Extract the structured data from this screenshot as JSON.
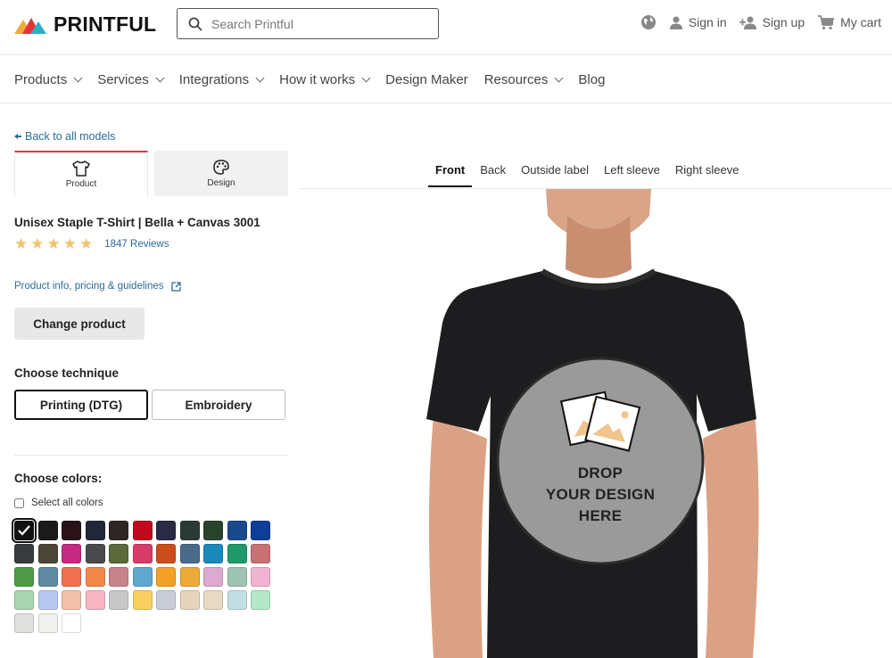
{
  "header": {
    "logo_text": "PRINTFUL",
    "search_placeholder": "Search Printful",
    "actions": {
      "language_icon": "globe-icon",
      "sign_in": "Sign in",
      "sign_up": "Sign up",
      "cart": "My cart"
    }
  },
  "nav": {
    "items": [
      {
        "label": "Products",
        "dropdown": true
      },
      {
        "label": "Services",
        "dropdown": true
      },
      {
        "label": "Integrations",
        "dropdown": true
      },
      {
        "label": "How it works",
        "dropdown": true
      },
      {
        "label": "Design Maker",
        "dropdown": false
      },
      {
        "label": "Resources",
        "dropdown": true
      },
      {
        "label": "Blog",
        "dropdown": false
      }
    ]
  },
  "left_panel": {
    "back_link": "Back to all models",
    "tabs": [
      {
        "label": "Product",
        "icon": "tshirt-icon",
        "active": true
      },
      {
        "label": "Design",
        "icon": "palette-icon",
        "active": false
      }
    ],
    "product_title": "Unisex Staple T-Shirt | Bella + Canvas 3001",
    "rating": {
      "stars": 5,
      "reviews": "1847 Reviews"
    },
    "info_link": "Product info, pricing & guidelines",
    "change_button": "Change product",
    "technique": {
      "label": "Choose technique",
      "options": [
        {
          "label": "Printing (DTG)",
          "selected": true
        },
        {
          "label": "Embroidery",
          "selected": false
        }
      ]
    },
    "colors": {
      "label": "Choose colors:",
      "select_all": "Select all colors",
      "swatches": [
        "#111111",
        "#1a1a1a",
        "#2a1318",
        "#222638",
        "#2d2624",
        "#c00a1c",
        "#2a2a44",
        "#2a3a35",
        "#27432c",
        "#1a4a8c",
        "#0c3e9a",
        "#3a3b3d",
        "#4c4637",
        "#c42a82",
        "#4a4a4c",
        "#5a6a3a",
        "#d83c6a",
        "#c94e1c",
        "#4a6a8a",
        "#1a8abb",
        "#1f9a6a",
        "#c87275",
        "#4f9a46",
        "#5f8aa4",
        "#f07050",
        "#f0884a",
        "#c8828a",
        "#5ea8d0",
        "#f2a124",
        "#ecaa3a",
        "#dcaad0",
        "#a0c4b4",
        "#f0b4d0",
        "#a8d4b0",
        "#b8c6f2",
        "#f2c0a8",
        "#f6b6c2",
        "#c8c8c8",
        "#f8d060",
        "#c8cdd8",
        "#e8d4bc",
        "#e8d8c4",
        "#c0e0e4",
        "#b4e8c8",
        "#e0e0dc",
        "#f0f0ec",
        "#ffffff"
      ],
      "selected_index": 0
    }
  },
  "preview": {
    "view_tabs": [
      {
        "label": "Front",
        "active": true
      },
      {
        "label": "Back",
        "active": false
      },
      {
        "label": "Outside label",
        "active": false
      },
      {
        "label": "Left sleeve",
        "active": false
      },
      {
        "label": "Right sleeve",
        "active": false
      }
    ],
    "drop_zone": {
      "line1": "DROP",
      "line2": "YOUR DESIGN",
      "line3": "HERE"
    }
  }
}
